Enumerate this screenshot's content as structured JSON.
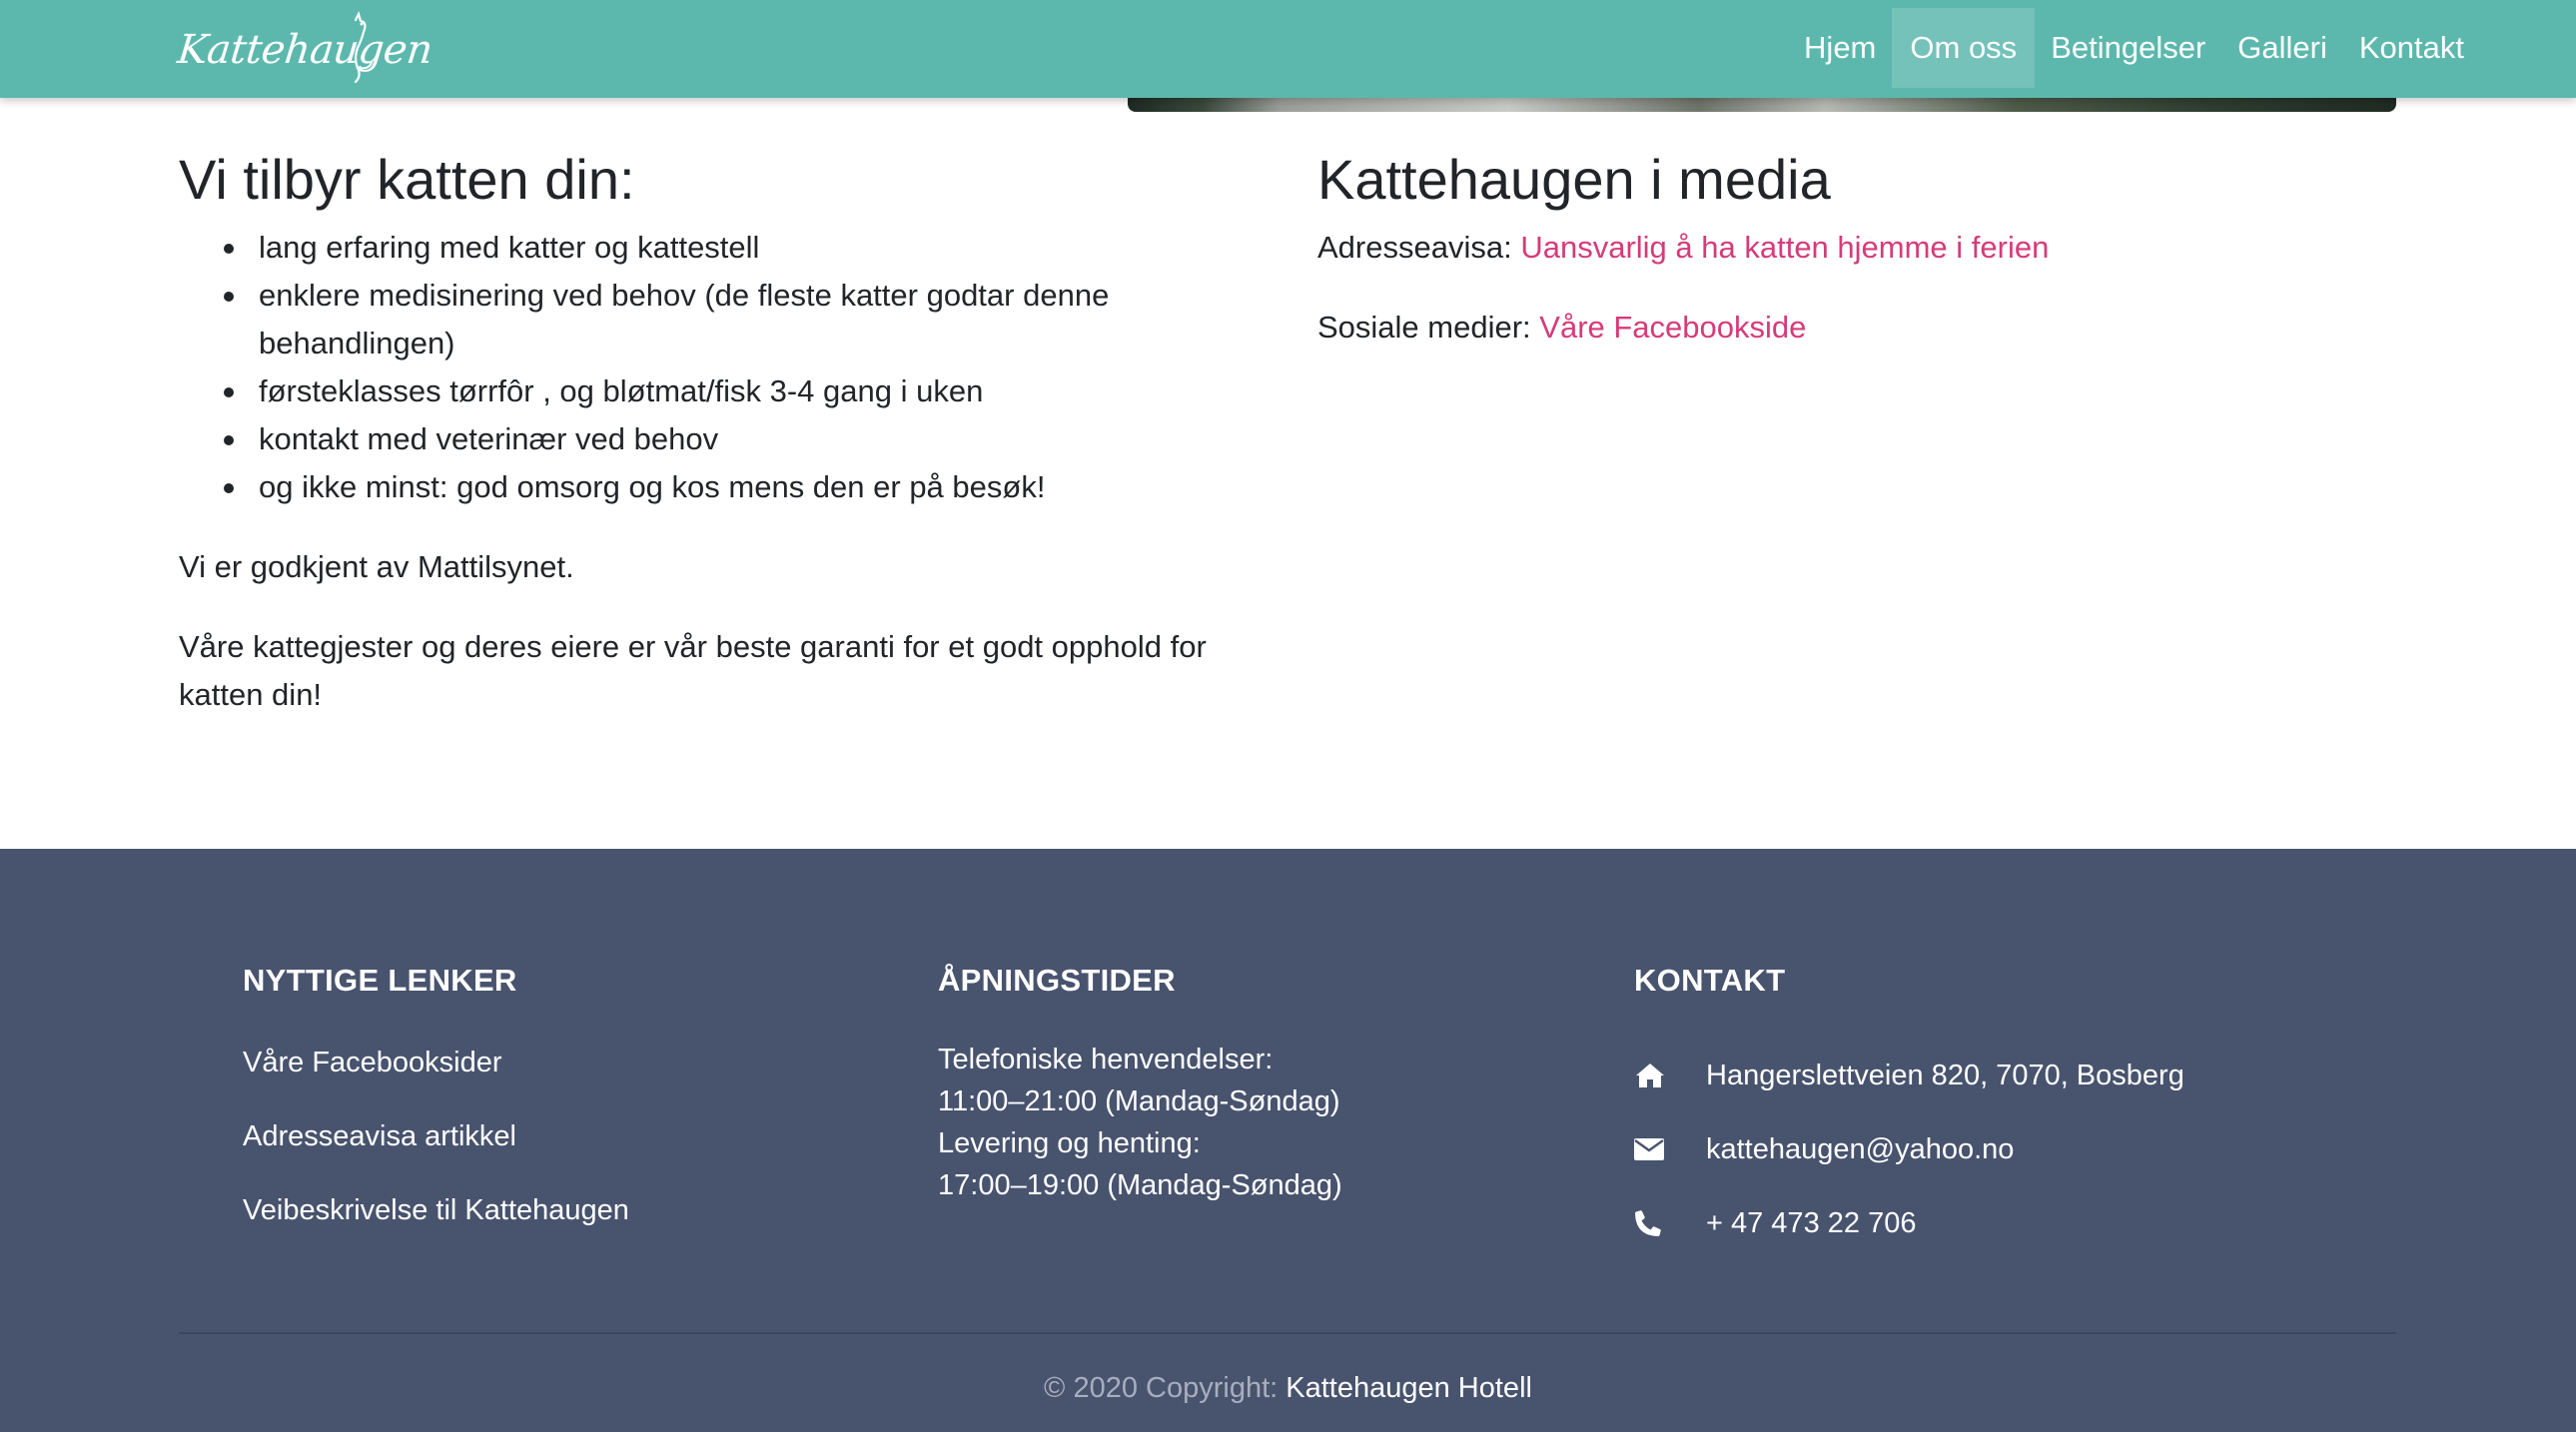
{
  "navbar": {
    "brand": "Kattehaugen",
    "links": [
      {
        "label": "Hjem",
        "active": false
      },
      {
        "label": "Om oss",
        "active": true
      },
      {
        "label": "Betingelser",
        "active": false
      },
      {
        "label": "Galleri",
        "active": false
      },
      {
        "label": "Kontakt",
        "active": false
      }
    ]
  },
  "offer": {
    "title": "Vi tilbyr katten din:",
    "items": [
      "lang erfaring med katter og kattestell",
      "enklere medisinering ved behov (de fleste katter godtar denne behandlingen)",
      "førsteklasses tørrfôr , og bløtmat/fisk 3-4 gang i uken",
      "kontakt med veterinær ved behov",
      "og ikke minst: god omsorg og kos mens den er på besøk!"
    ],
    "approval": "Vi er godkjent av Mattilsynet.",
    "guarantee": "Våre kattegjester og deres eiere er vår beste garanti for et godt opphold for katten din!"
  },
  "media": {
    "title": "Kattehaugen i media",
    "newspaper_label": "Adresseavisa:",
    "newspaper_link": "Uansvarlig å ha katten hjemme i ferien",
    "social_label": "Sosiale medier:",
    "social_link": "Våre Facebookside"
  },
  "footer": {
    "links_heading": "NYTTIGE LENKER",
    "links": [
      "Våre Facebooksider",
      "Adresseavisa artikkel",
      "Veibeskrivelse til Kattehaugen"
    ],
    "hours_heading": "ÅPNINGSTIDER",
    "hours": [
      "Telefoniske henvendelser:",
      "11:00–21:00 (Mandag-Søndag)",
      "Levering og henting:",
      "17:00–19:00 (Mandag-Søndag)"
    ],
    "contact_heading": "KONTAKT",
    "contact": [
      {
        "icon": "home-icon",
        "text": "Hangerslettveien 820, 7070, Bosberg"
      },
      {
        "icon": "envelope-icon",
        "text": "kattehaugen@yahoo.no"
      },
      {
        "icon": "phone-icon",
        "text": "+ 47 473 22 706"
      }
    ],
    "copyright_prefix": "© 2020 Copyright:",
    "copyright_link": "Kattehaugen Hotell"
  },
  "colors": {
    "navbar": "#5cb8ad",
    "footer": "#48536e",
    "link": "#d63b79"
  }
}
